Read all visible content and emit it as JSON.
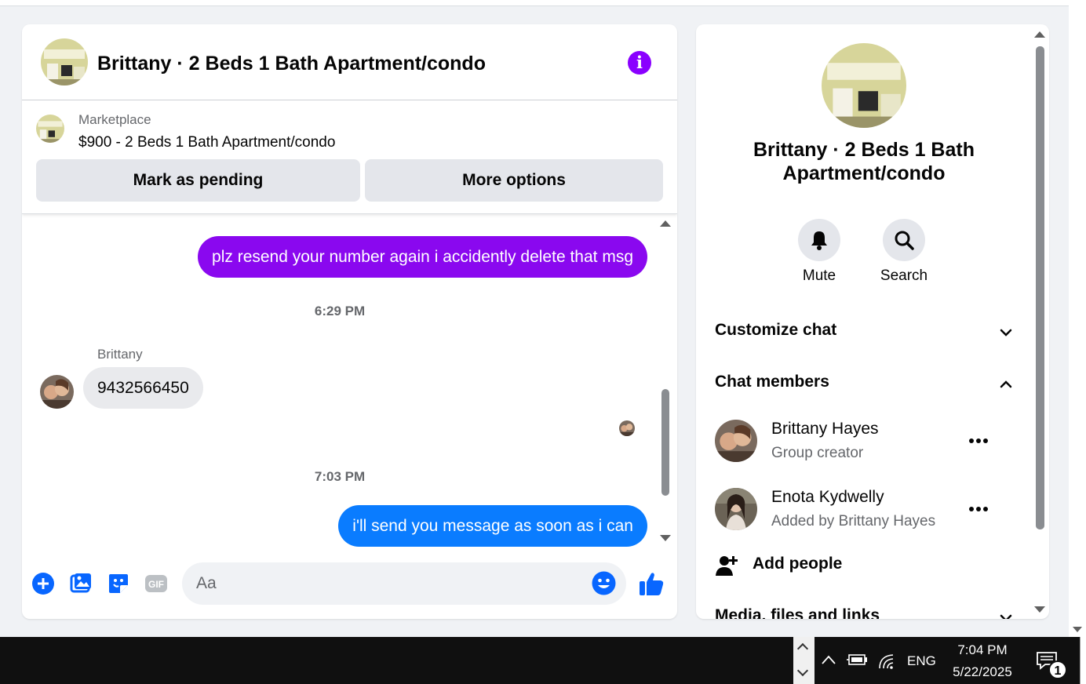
{
  "chat": {
    "title": "Brittany · 2 Beds 1 Bath Apartment/condo",
    "marketplace": {
      "label": "Marketplace",
      "listing": "$900 - 2 Beds 1 Bath Apartment/condo",
      "mark_pending": "Mark as pending",
      "more_options": "More options"
    },
    "messages": {
      "outgoing_1": "plz resend your number again i accidently delete that msg",
      "time_1": "6:29 PM",
      "sender": "Brittany",
      "incoming_1": "9432566450",
      "time_2": "7:03 PM",
      "outgoing_2": "i'll send you message as soon as i can"
    },
    "composer": {
      "placeholder": "Aa"
    }
  },
  "info": {
    "title": "Brittany · 2 Beds 1 Bath Apartment/condo",
    "mute_label": "Mute",
    "search_label": "Search",
    "customize": "Customize chat",
    "members_heading": "Chat members",
    "members": [
      {
        "name": "Brittany Hayes",
        "subtitle": "Group creator"
      },
      {
        "name": "Enota Kydwelly",
        "subtitle": "Added by Brittany Hayes"
      }
    ],
    "add_people": "Add people",
    "media": "Media, files and links"
  },
  "taskbar": {
    "language": "ENG",
    "time": "7:04 PM",
    "date": "5/22/2025",
    "notification_count": "1"
  },
  "colors": {
    "accent_purple": "#8a08ef",
    "message_blue": "#0a7cff",
    "icon_blue": "#0866ff"
  }
}
